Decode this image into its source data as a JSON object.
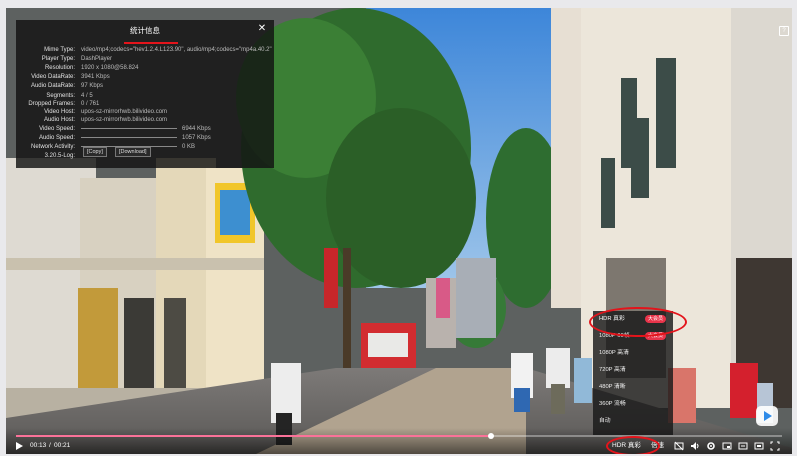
{
  "stats": {
    "title": "统计信息",
    "close": "✕",
    "rows": [
      {
        "label": "Mime Type:",
        "value": "video/mp4;codecs=\"hev1.2.4.L123.90\", audio/mp4;codecs=\"mp4a.40.2\""
      },
      {
        "label": "Player Type:",
        "value": "DashPlayer"
      },
      {
        "label": "Resolution:",
        "value": "1920 x 1080@58.824"
      },
      {
        "label": "Video DataRate:",
        "value": "3941 Kbps"
      },
      {
        "label": "Audio DataRate:",
        "value": "97 Kbps"
      },
      {
        "label": "Segments:",
        "value": "4 / 5"
      },
      {
        "label": "Dropped Frames:",
        "value": "0 / 761"
      },
      {
        "label": "Video Host:",
        "value": "upos-sz-mirrorhwb.bilivideo.com"
      },
      {
        "label": "Audio Host:",
        "value": "upos-sz-mirrorhwb.bilivideo.com"
      },
      {
        "label": "Video Speed:",
        "value": "6944 Kbps"
      },
      {
        "label": "Audio Speed:",
        "value": "1057 Kbps"
      },
      {
        "label": "Network Activity:",
        "value": "0 KB"
      },
      {
        "label": "3.20.5-Log:",
        "value": ""
      }
    ],
    "copy_label": "[Copy]",
    "download_label": "[Download]"
  },
  "quality_menu": {
    "items": [
      {
        "label": "HDR 真彩",
        "badge": "大会员",
        "selected": true
      },
      {
        "label": "1080P 60帧",
        "badge": "大会员",
        "selected": false
      },
      {
        "label": "1080P 高清",
        "badge": "",
        "selected": false
      },
      {
        "label": "720P 高清",
        "badge": "",
        "selected": false
      },
      {
        "label": "480P 清晰",
        "badge": "",
        "selected": false
      },
      {
        "label": "360P 流畅",
        "badge": "",
        "selected": false
      },
      {
        "label": "自动",
        "badge": "",
        "selected": false
      }
    ]
  },
  "controls": {
    "current_time": "00:13",
    "separator": "/",
    "duration": "00:21",
    "progress": 0.62,
    "quality_label": "HDR 真彩",
    "speed_label": "倍速"
  },
  "colors": {
    "accent": "#fb7299",
    "badge": "#e8344a",
    "annotation": "#e3141b"
  }
}
